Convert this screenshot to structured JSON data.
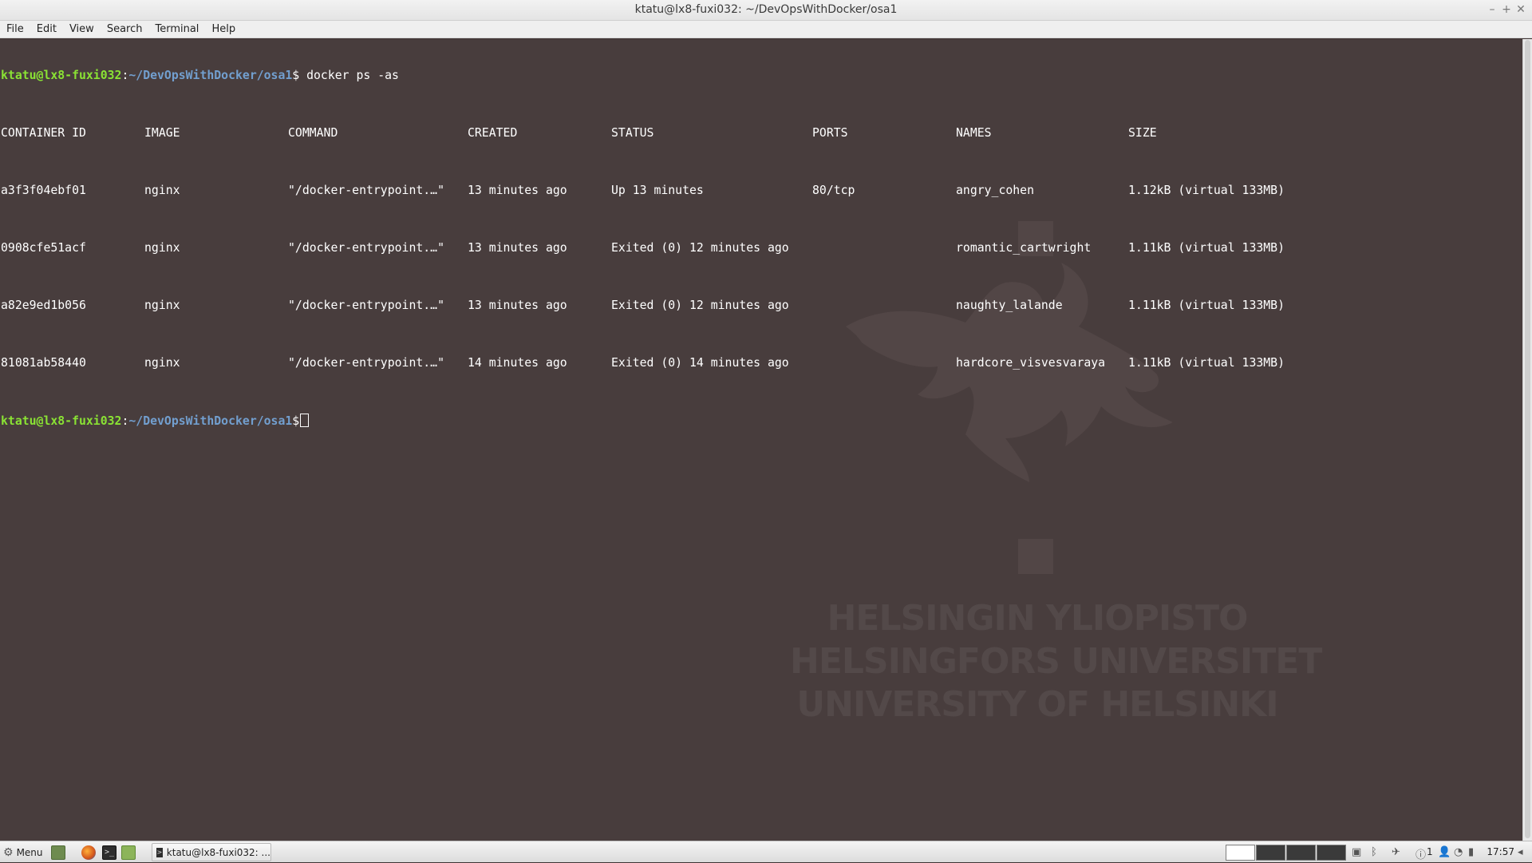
{
  "window": {
    "title": "ktatu@lx8-fuxi032: ~/DevOpsWithDocker/osa1",
    "controls": [
      "–",
      "+",
      "✕"
    ]
  },
  "menubar": [
    "File",
    "Edit",
    "View",
    "Search",
    "Terminal",
    "Help"
  ],
  "prompt": {
    "user_host": "ktatu@lx8-fuxi032",
    "separator": ":",
    "path": "~/DevOpsWithDocker/osa1",
    "symbol": "$"
  },
  "command": " docker ps -as",
  "table": {
    "headers": [
      "CONTAINER ID",
      "IMAGE",
      "COMMAND",
      "CREATED",
      "STATUS",
      "PORTS",
      "NAMES",
      "SIZE"
    ],
    "rows": [
      [
        "a3f3f04ebf01",
        "nginx",
        "\"/docker-entrypoint.…\"",
        "13 minutes ago",
        "Up 13 minutes",
        "80/tcp",
        "angry_cohen",
        "1.12kB (virtual 133MB)"
      ],
      [
        "0908cfe51acf",
        "nginx",
        "\"/docker-entrypoint.…\"",
        "13 minutes ago",
        "Exited (0) 12 minutes ago",
        "",
        "romantic_cartwright",
        "1.11kB (virtual 133MB)"
      ],
      [
        "a82e9ed1b056",
        "nginx",
        "\"/docker-entrypoint.…\"",
        "13 minutes ago",
        "Exited (0) 12 minutes ago",
        "",
        "naughty_lalande",
        "1.11kB (virtual 133MB)"
      ],
      [
        "81081ab58440",
        "nginx",
        "\"/docker-entrypoint.…\"",
        "14 minutes ago",
        "Exited (0) 14 minutes ago",
        "",
        "hardcore_visvesvaraya",
        "1.11kB (virtual 133MB)"
      ]
    ]
  },
  "watermark": {
    "lines": [
      "HELSINGIN YLIOPISTO",
      "HELSINGFORS UNIVERSITET",
      "UNIVERSITY OF HELSINKI"
    ]
  },
  "taskbar": {
    "menu_label": "Menu",
    "task_label": "ktatu@lx8-fuxi032: ...",
    "tray_count": "1",
    "clock": "17:57"
  },
  "colors": {
    "terminal_bg": "#483d3d",
    "prompt_user": "#8ae234",
    "prompt_path": "#729fcf"
  },
  "icons": [
    "gear-icon",
    "show-desktop-icon",
    "firefox-icon",
    "terminal-launcher-icon",
    "files-icon",
    "terminal-task-icon",
    "network-icon",
    "info-icon",
    "user-icon",
    "wifi-icon",
    "battery-icon",
    "volume-icon"
  ]
}
